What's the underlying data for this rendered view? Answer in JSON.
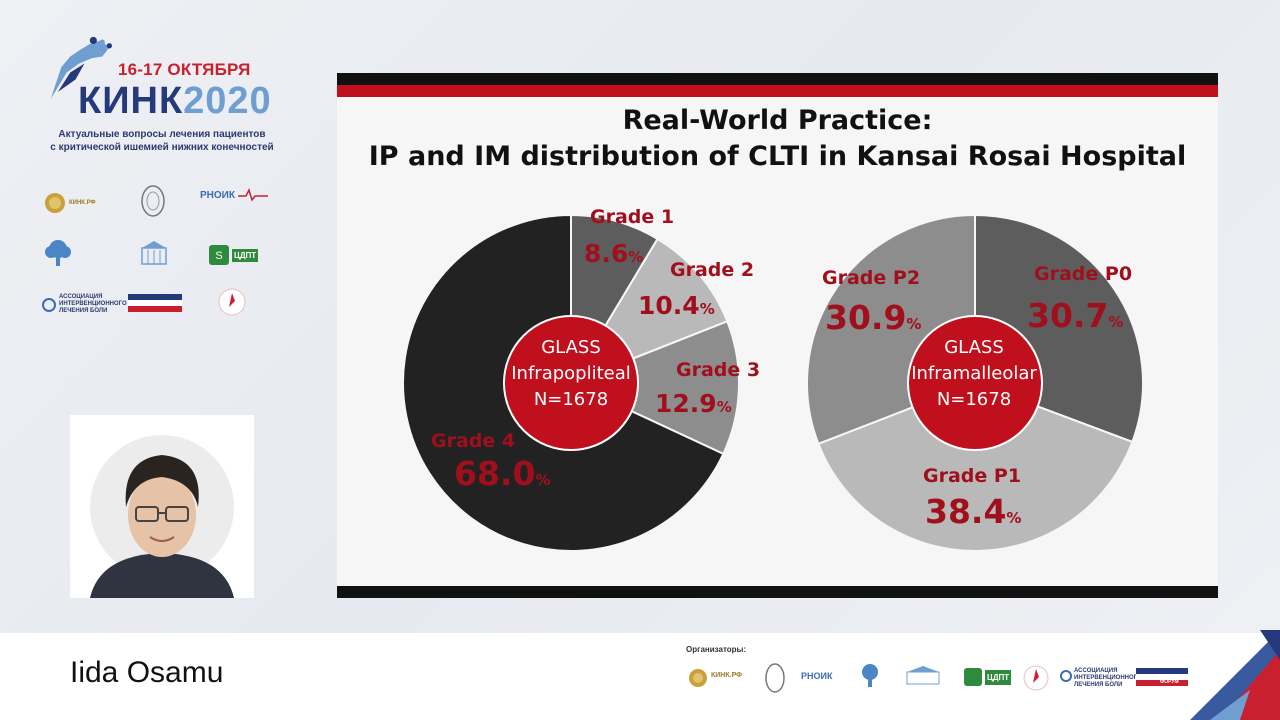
{
  "event": {
    "dates": "16-17 ОКТЯБРЯ",
    "name": "КИНК",
    "year": "2020",
    "subtitle_line1": "Актуальные вопросы лечения пациентов",
    "subtitle_line2": "с критической ишемией нижних конечностей"
  },
  "sponsors": {
    "kink_rf": "КИНК.РФ",
    "rnoik": "РНОИК",
    "czdt": "ЦДПТ",
    "association": "АССОЦИАЦИЯ ИНТЕРВЕНЦИОННОГО ЛЕЧЕНИЯ БОЛИ",
    "forum": "ФОРУМ"
  },
  "slide": {
    "title_line1": "Real-World Practice:",
    "title_line2": "IP and IM distribution of CLTI in Kansai Rosai Hospital"
  },
  "speaker": {
    "name": "Iida Osamu"
  },
  "footer": {
    "organizers_label": "Организаторы:"
  },
  "colors": {
    "accent_red": "#c0101e",
    "label_red": "#a0101c",
    "navy": "#243a7a"
  },
  "chart_data": [
    {
      "type": "pie",
      "title": "",
      "center_label": [
        "GLASS",
        "Infrapopliteal",
        "N=1678"
      ],
      "categories": [
        "Grade 1",
        "Grade 2",
        "Grade 3",
        "Grade 4"
      ],
      "values": [
        8.6,
        10.4,
        12.9,
        68.0
      ],
      "value_labels": [
        "8.6",
        "10.4",
        "12.9",
        "68.0"
      ],
      "unit": "%",
      "colors": [
        "#5d5d5d",
        "#b9b9b9",
        "#8d8d8d",
        "#222222"
      ]
    },
    {
      "type": "pie",
      "title": "",
      "center_label": [
        "GLASS",
        "Inframalleolar",
        "N=1678"
      ],
      "categories": [
        "Grade P0",
        "Grade P1",
        "Grade P2"
      ],
      "values": [
        30.7,
        38.4,
        30.9
      ],
      "value_labels": [
        "30.7",
        "38.4",
        "30.9"
      ],
      "unit": "%",
      "colors": [
        "#5d5d5d",
        "#b9b9b9",
        "#8d8d8d"
      ]
    }
  ]
}
